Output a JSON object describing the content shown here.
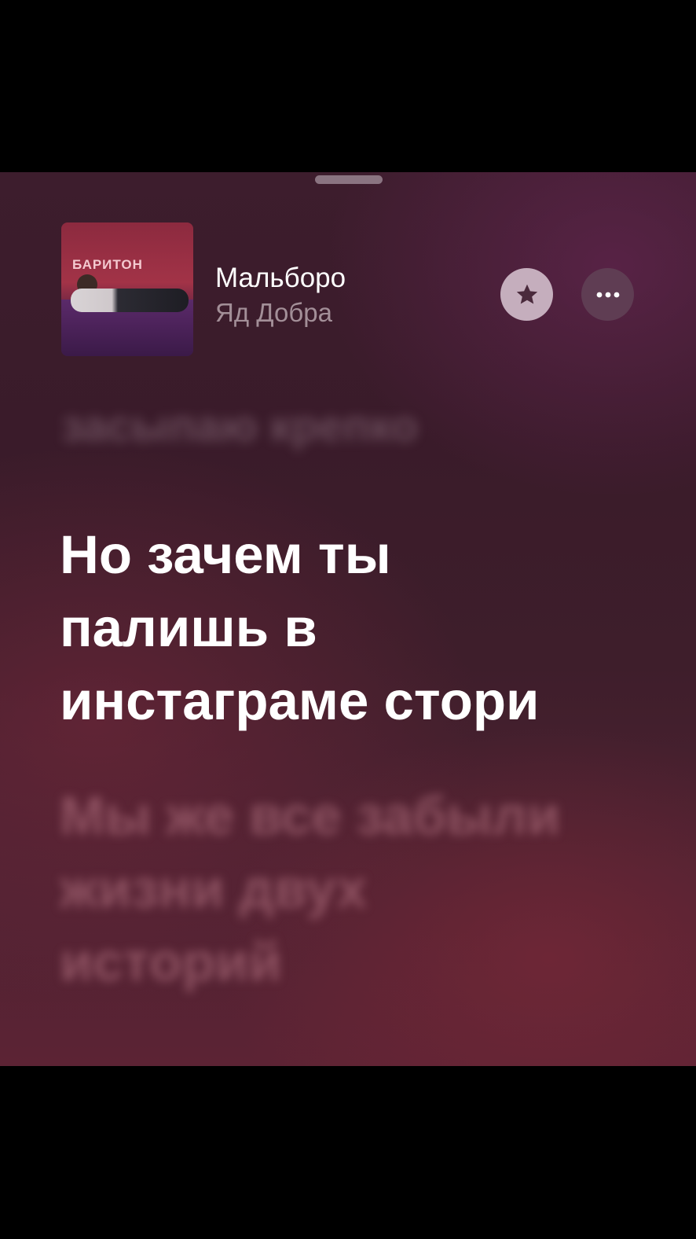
{
  "track": {
    "title": "Мальборо",
    "artist": "Яд Добра",
    "cover_text": "БАРИТОН"
  },
  "actions": {
    "favorite_icon": "star-icon",
    "more_icon": "ellipsis-icon"
  },
  "lyrics": {
    "previous": "засыпаю крепко",
    "current": [
      "Но зачем ты",
      "палишь в",
      "инстаграме стори"
    ],
    "next": [
      "Мы же все забыли",
      "жизни двух",
      "историй"
    ]
  },
  "colors": {
    "favorite_button_bg": "#c5aebd",
    "more_button_bg": "#5f3d53",
    "current_lyric": "#ffffff",
    "artist_text": "#a38f98"
  }
}
